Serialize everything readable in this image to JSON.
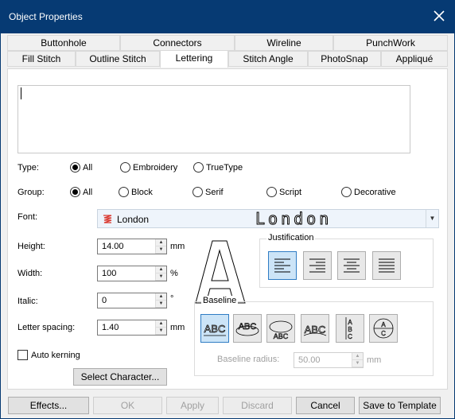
{
  "window": {
    "title": "Object Properties"
  },
  "tabs_row1": [
    "Buttonhole",
    "Connectors",
    "Wireline",
    "PunchWork"
  ],
  "tabs_row2": [
    "Fill Stitch",
    "Outline Stitch",
    "Lettering",
    "Stitch Angle",
    "PhotoSnap",
    "Appliqué"
  ],
  "active_tab": "Lettering",
  "text_value": "",
  "type": {
    "label": "Type:",
    "options": [
      {
        "label": "All",
        "selected": true
      },
      {
        "label": "Embroidery",
        "selected": false
      },
      {
        "label": "TrueType",
        "selected": false
      }
    ]
  },
  "group": {
    "label": "Group:",
    "options": [
      {
        "label": "All",
        "selected": true
      },
      {
        "label": "Block",
        "selected": false
      },
      {
        "label": "Serif",
        "selected": false
      },
      {
        "label": "Script",
        "selected": false
      },
      {
        "label": "Decorative",
        "selected": false
      }
    ]
  },
  "font": {
    "label": "Font:",
    "name": "London",
    "preview": "London",
    "icon": "embroidery-font-icon"
  },
  "height": {
    "label": "Height:",
    "value": "14.00",
    "unit": "mm"
  },
  "width": {
    "label": "Width:",
    "value": "100",
    "unit": "%"
  },
  "italic": {
    "label": "Italic:",
    "value": "0",
    "unit": "°"
  },
  "letter_spacing": {
    "label": "Letter spacing:",
    "value": "1.40",
    "unit": "mm"
  },
  "auto_kerning": {
    "label": "Auto kerning",
    "checked": false
  },
  "select_character_label": "Select Character...",
  "preview_letter": "A",
  "justification": {
    "title": "Justification",
    "options": [
      "align-left-icon",
      "align-right-icon",
      "align-center-icon",
      "align-justify-icon"
    ],
    "selected": "align-left-icon"
  },
  "baseline": {
    "title": "Baseline",
    "sample": "ABC",
    "options": [
      "baseline-straight-icon",
      "baseline-arc-top-icon",
      "baseline-circle-icon",
      "baseline-slant-icon",
      "baseline-vertical-icon",
      "baseline-circle-split-icon"
    ],
    "selected": "baseline-straight-icon",
    "radius_label": "Baseline radius:",
    "radius_value": "50.00",
    "radius_unit": "mm"
  },
  "buttons": {
    "effects": "Effects...",
    "ok": "OK",
    "apply": "Apply",
    "discard": "Discard",
    "cancel": "Cancel",
    "save_template": "Save to Template"
  },
  "colors": {
    "titlebar": "#063a73",
    "selected_button": "#cce4f7",
    "font_icon": "#d9342b"
  }
}
